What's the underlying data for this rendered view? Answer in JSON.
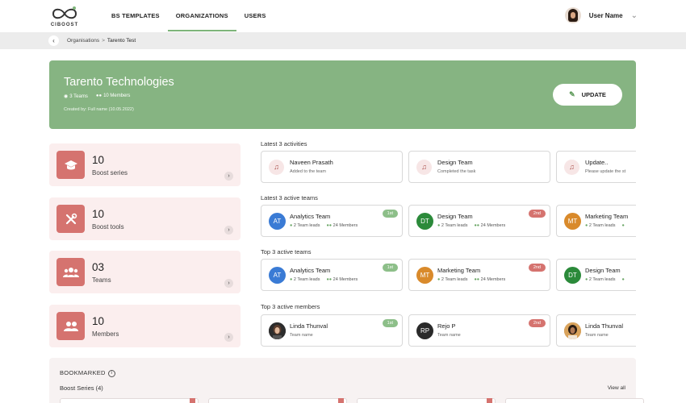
{
  "app": {
    "logo_text": "CIBOOST"
  },
  "nav": {
    "items": [
      {
        "label": "BS TEMPLATES",
        "active": false
      },
      {
        "label": "ORGANIZATIONS",
        "active": true
      },
      {
        "label": "USERS",
        "active": false
      }
    ]
  },
  "user": {
    "name": "User Name"
  },
  "breadcrumb": {
    "items": [
      "Organisations",
      "Tarento Test"
    ]
  },
  "org": {
    "name": "Tarento Technologies",
    "teams": "3 Teams",
    "members": "10 Members",
    "created": "Created by: Full name (10.05.2022)",
    "update_label": "UPDATE"
  },
  "stats": [
    {
      "value": "10",
      "label": "Boost series",
      "icon": "graduation-cap-icon"
    },
    {
      "value": "10",
      "label": "Boost tools",
      "icon": "tools-icon"
    },
    {
      "value": "03",
      "label": "Teams",
      "icon": "team-icon"
    },
    {
      "value": "10",
      "label": "Members",
      "icon": "members-icon"
    }
  ],
  "activities": {
    "title": "Latest 3 activities",
    "items": [
      {
        "title": "Naveen Prasath",
        "sub": "Added to the team"
      },
      {
        "title": "Design Team",
        "sub": "Completed the task"
      },
      {
        "title": "Update..",
        "sub": "Please update the st"
      }
    ]
  },
  "latest_teams": {
    "title": "Latest 3 active teams",
    "items": [
      {
        "initials": "AT",
        "name": "Analytics Team",
        "leads": "2 Team leads",
        "members": "24 Members",
        "badge": "1st",
        "color": "#3a7bd5"
      },
      {
        "initials": "DT",
        "name": "Design Team",
        "leads": "2 Team leads",
        "members": "24 Members",
        "badge": "2nd",
        "color": "#2b8a3a"
      },
      {
        "initials": "MT",
        "name": "Marketing Team",
        "leads": "2 Team leads",
        "members": "",
        "badge": "",
        "color": "#d98a2b"
      }
    ]
  },
  "top_teams": {
    "title": "Top 3 active teams",
    "items": [
      {
        "initials": "AT",
        "name": "Analytics Team",
        "leads": "2 Team leads",
        "members": "24 Members",
        "badge": "1st",
        "color": "#3a7bd5"
      },
      {
        "initials": "MT",
        "name": "Marketing Team",
        "leads": "2 Team leads",
        "members": "24 Members",
        "badge": "2nd",
        "color": "#d98a2b"
      },
      {
        "initials": "DT",
        "name": "Design Team",
        "leads": "2 Team leads",
        "members": "",
        "badge": "",
        "color": "#2b8a3a"
      }
    ]
  },
  "top_members": {
    "title": "Top 3 active members",
    "items": [
      {
        "initials": "",
        "name": "Linda Thunval",
        "sub": "Team name",
        "badge": "1st",
        "color": "#333333"
      },
      {
        "initials": "RP",
        "name": "Rejo P",
        "sub": "Team name",
        "badge": "2nd",
        "color": "#2a2a2a"
      },
      {
        "initials": "",
        "name": "Linda Thunval",
        "sub": "Team name",
        "badge": "",
        "color": "#c98d4a"
      }
    ]
  },
  "bookmarked": {
    "title": "BOOKMARKED",
    "info": "i",
    "series_label": "Boost Series (4)",
    "view_all": "View all"
  },
  "colors": {
    "accent": "#86b482",
    "brand_red": "#d5736f",
    "stat_bg": "#fbeeee"
  }
}
